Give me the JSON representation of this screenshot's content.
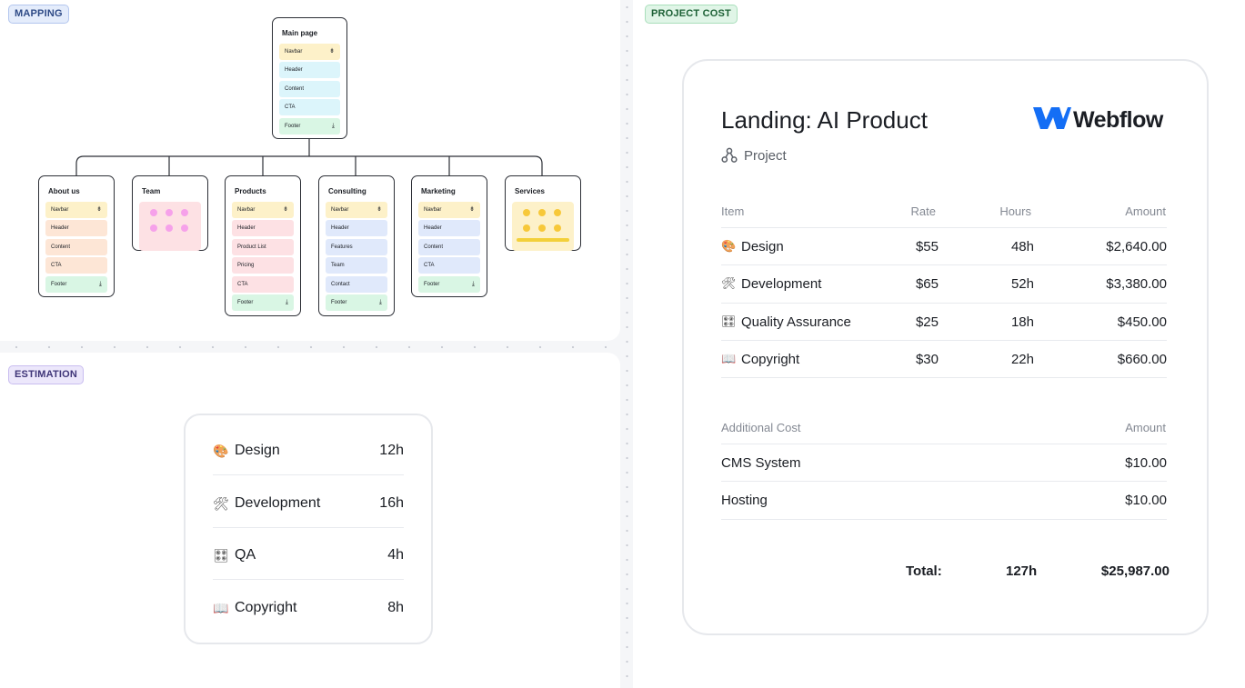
{
  "tags": {
    "mapping": "MAPPING",
    "estimation": "ESTIMATION",
    "project_cost": "PROJECT COST"
  },
  "sitemap": {
    "main": {
      "title": "Main page",
      "rows": [
        {
          "label": "Navbar",
          "color": "yellow",
          "icon": "collapse-icon"
        },
        {
          "label": "Header",
          "color": "cyan"
        },
        {
          "label": "Content",
          "color": "cyan"
        },
        {
          "label": "CTA",
          "color": "cyan"
        },
        {
          "label": "Footer",
          "color": "green",
          "icon": "download-icon"
        }
      ]
    },
    "children": [
      {
        "title": "About us",
        "rows": [
          {
            "label": "Navbar",
            "color": "yellow",
            "icon": "collapse-icon"
          },
          {
            "label": "Header",
            "color": "peach"
          },
          {
            "label": "Content",
            "color": "peach"
          },
          {
            "label": "CTA",
            "color": "peach"
          },
          {
            "label": "Footer",
            "color": "green",
            "icon": "download-icon"
          }
        ]
      },
      {
        "title": "Team",
        "thumb": "pink"
      },
      {
        "title": "Products",
        "rows": [
          {
            "label": "Navbar",
            "color": "yellow",
            "icon": "collapse-icon"
          },
          {
            "label": "Header",
            "color": "pink"
          },
          {
            "label": "Product List",
            "color": "pink"
          },
          {
            "label": "Pricing",
            "color": "pink"
          },
          {
            "label": "CTA",
            "color": "pink"
          },
          {
            "label": "Footer",
            "color": "green",
            "icon": "download-icon"
          }
        ]
      },
      {
        "title": "Consulting",
        "rows": [
          {
            "label": "Navbar",
            "color": "yellow",
            "icon": "collapse-icon"
          },
          {
            "label": "Header",
            "color": "blue"
          },
          {
            "label": "Features",
            "color": "blue"
          },
          {
            "label": "Team",
            "color": "blue"
          },
          {
            "label": "Contact",
            "color": "blue"
          },
          {
            "label": "Footer",
            "color": "green",
            "icon": "download-icon"
          }
        ]
      },
      {
        "title": "Marketing",
        "rows": [
          {
            "label": "Navbar",
            "color": "yellow",
            "icon": "collapse-icon"
          },
          {
            "label": "Header",
            "color": "blue"
          },
          {
            "label": "Content",
            "color": "blue"
          },
          {
            "label": "CTA",
            "color": "blue"
          },
          {
            "label": "Footer",
            "color": "green",
            "icon": "download-icon"
          }
        ]
      },
      {
        "title": "Services",
        "thumb": "yellow"
      }
    ]
  },
  "estimation": [
    {
      "icon": "palette-icon",
      "glyph": "🎨",
      "label": "Design",
      "value": "12h"
    },
    {
      "icon": "tools-icon",
      "glyph": "🛠",
      "label": "Development",
      "value": "16h"
    },
    {
      "icon": "control-knobs-icon",
      "glyph": "🎛",
      "label": "QA",
      "value": "4h"
    },
    {
      "icon": "book-icon",
      "glyph": "📖",
      "label": "Copyright",
      "value": "8h"
    }
  ],
  "cost": {
    "title": "Landing: AI Product",
    "subtitle": "Project",
    "logo": "Webflow",
    "headers": {
      "item": "Item",
      "rate": "Rate",
      "hours": "Hours",
      "amount": "Amount"
    },
    "items": [
      {
        "icon": "palette-icon",
        "glyph": "🎨",
        "item": "Design",
        "rate": "$55",
        "hours": "48h",
        "amount": "$2,640.00"
      },
      {
        "icon": "tools-icon",
        "glyph": "🛠",
        "item": "Development",
        "rate": "$65",
        "hours": "52h",
        "amount": "$3,380.00"
      },
      {
        "icon": "control-knobs-icon",
        "glyph": "🎛",
        "item": "Quality Assurance",
        "rate": "$25",
        "hours": "18h",
        "amount": "$450.00"
      },
      {
        "icon": "book-icon",
        "glyph": "📖",
        "item": "Copyright",
        "rate": "$30",
        "hours": "22h",
        "amount": "$660.00"
      }
    ],
    "additional_headers": {
      "item": "Additional Cost",
      "amount": "Amount"
    },
    "additional": [
      {
        "item": "CMS System",
        "amount": "$10.00"
      },
      {
        "item": "Hosting",
        "amount": "$10.00"
      }
    ],
    "total": {
      "label": "Total:",
      "hours": "127h",
      "amount": "$25,987.00"
    }
  },
  "colors": {
    "yellow": "#fdf1c9",
    "cyan": "#dcf5fb",
    "green": "#d9f6e4",
    "peach": "#fde6d6",
    "pink": "#fde1e4",
    "blue": "#e0e9fb",
    "brand": "#146ef5"
  }
}
